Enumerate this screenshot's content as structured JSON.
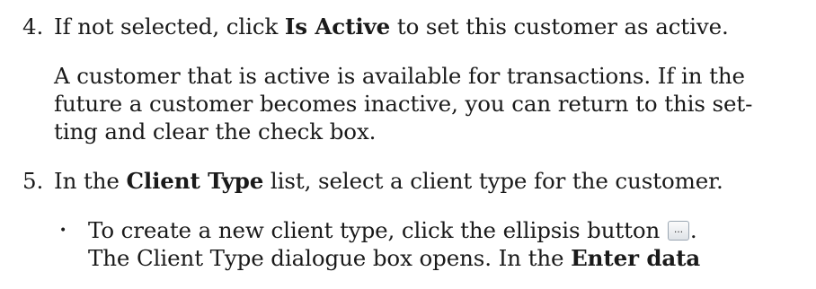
{
  "step4": {
    "number": "4.",
    "pre": "If not selected, click ",
    "bold": "Is Active",
    "post": " to set this customer as active.",
    "para_line1": "A customer that is active is available for transactions. If in the",
    "para_line2": "future a customer becomes inactive, you can return to this set-",
    "para_line3": "ting and clear the check box."
  },
  "step5": {
    "number": "5.",
    "pre": "In the ",
    "bold": "Client Type",
    "post": " list, select a client type for the customer.",
    "bullet": {
      "marker": "•",
      "line1_pre": "To create a new client type, click the ellipsis button ",
      "button_glyph": "...",
      "line1_post": ".",
      "line2_pre": "The Client Type dialogue box opens. In the ",
      "line2_bold": "Enter data"
    }
  }
}
